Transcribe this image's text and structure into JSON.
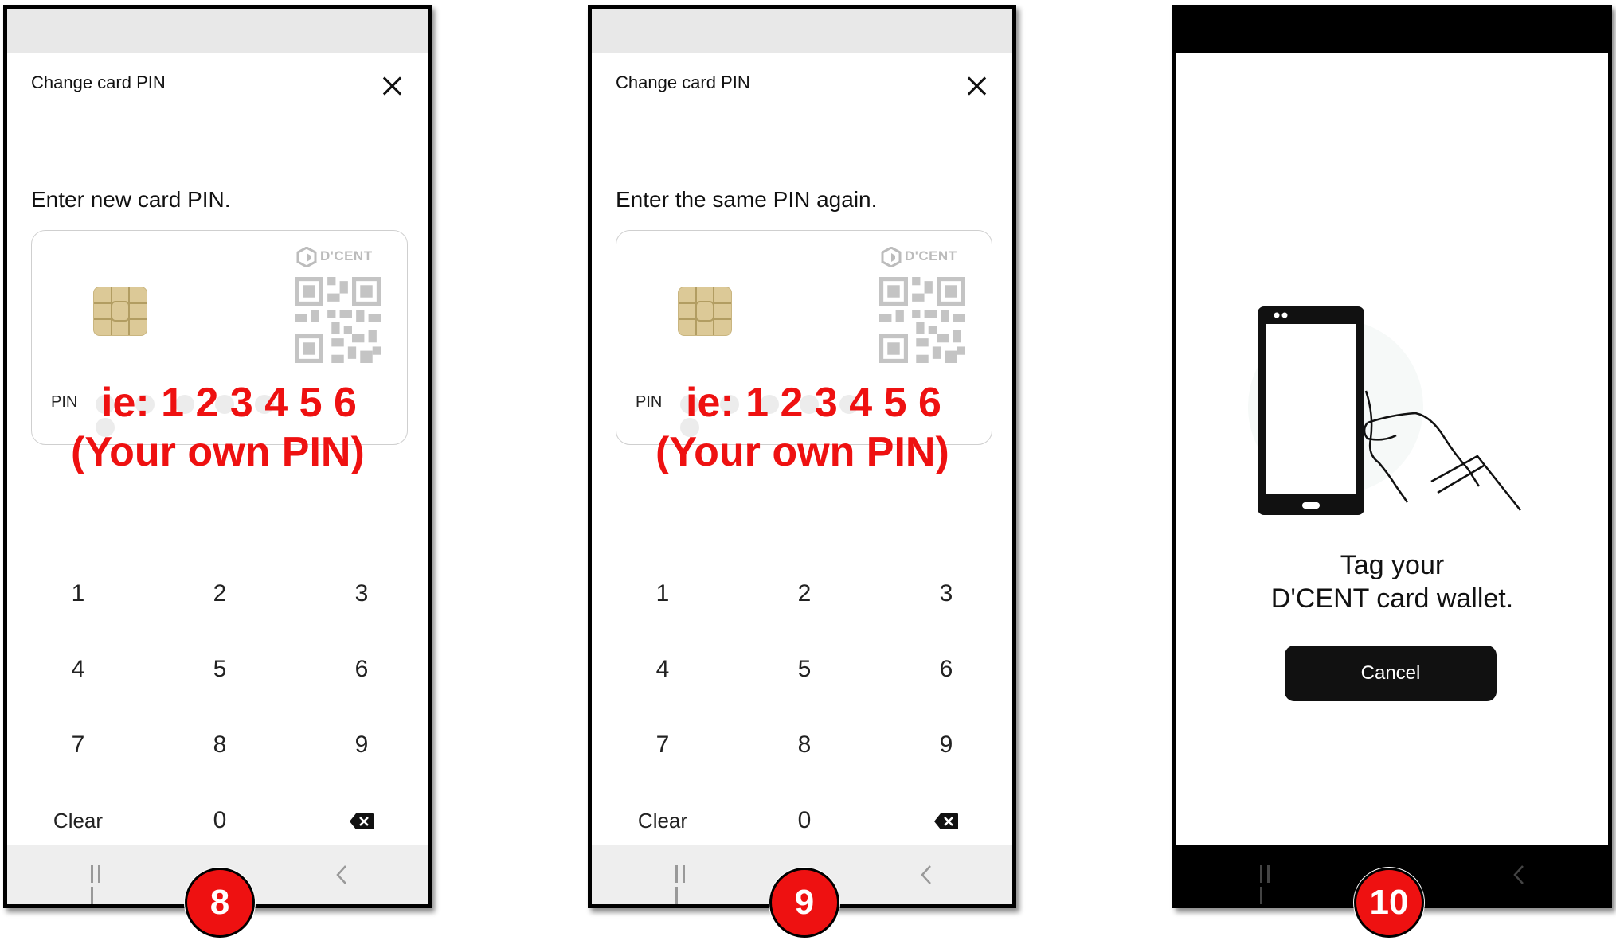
{
  "screens": [
    {
      "title": "Change card PIN",
      "instruction": "Enter new card PIN.",
      "pin_label": "PIN",
      "logo_text": "D'CENT",
      "overlay_pin": "ie: 1 2 3 4 5 6",
      "overlay_own": "(Your own PIN)",
      "step": "8"
    },
    {
      "title": "Change card PIN",
      "instruction": "Enter the same PIN again.",
      "pin_label": "PIN",
      "logo_text": "D'CENT",
      "overlay_pin": "ie: 1 2 3 4 5 6",
      "overlay_own": "(Your own PIN)",
      "step": "9"
    },
    {
      "tag_line1": "Tag your",
      "tag_line2": "D'CENT card wallet.",
      "cancel_label": "Cancel",
      "step": "10"
    }
  ],
  "keypad": {
    "k1": "1",
    "k2": "2",
    "k3": "3",
    "k4": "4",
    "k5": "5",
    "k6": "6",
    "k7": "7",
    "k8": "8",
    "k9": "9",
    "clear": "Clear",
    "k0": "0"
  },
  "colors": {
    "accent_red": "#ee1111",
    "button_dark": "#111111",
    "chip_gold": "#dcc997"
  },
  "icons": [
    "close-icon",
    "backspace-icon",
    "recents-icon",
    "back-icon",
    "sim-chip-icon",
    "qr-code-icon",
    "dcent-logo-icon",
    "phone-tap-icon"
  ]
}
